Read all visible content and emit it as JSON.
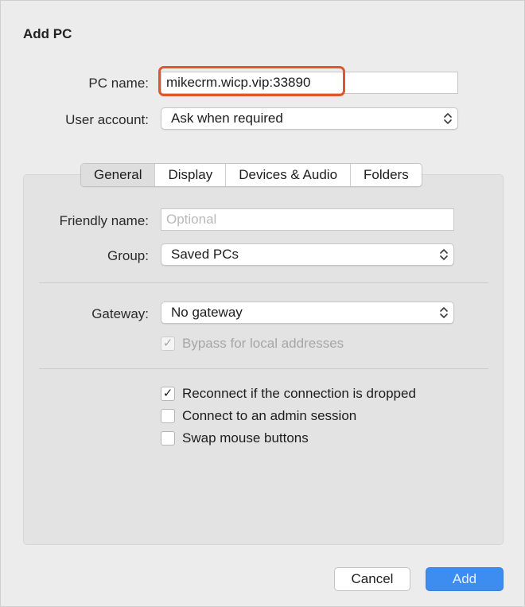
{
  "dialog": {
    "title": "Add PC"
  },
  "form": {
    "pc_name_label": "PC name:",
    "pc_name_value": "mikecrm.wicp.vip:33890",
    "user_account_label": "User account:",
    "user_account_value": "Ask when required"
  },
  "tabs": [
    {
      "label": "General",
      "active": true
    },
    {
      "label": "Display",
      "active": false
    },
    {
      "label": "Devices & Audio",
      "active": false
    },
    {
      "label": "Folders",
      "active": false
    }
  ],
  "general": {
    "friendly_name_label": "Friendly name:",
    "friendly_name_placeholder": "Optional",
    "friendly_name_value": "",
    "group_label": "Group:",
    "group_value": "Saved PCs",
    "gateway_label": "Gateway:",
    "gateway_value": "No gateway",
    "bypass_label": "Bypass for local addresses",
    "bypass_checked": true,
    "bypass_enabled": false,
    "reconnect_label": "Reconnect if the connection is dropped",
    "reconnect_checked": true,
    "admin_label": "Connect to an admin session",
    "admin_checked": false,
    "swap_label": "Swap mouse buttons",
    "swap_checked": false
  },
  "buttons": {
    "cancel_label": "Cancel",
    "add_label": "Add"
  },
  "colors": {
    "highlight": "#e0572c",
    "accent": "#3d8cf0"
  },
  "icons": {
    "checkmark": "✓",
    "popup": "chevron-updown-icon"
  }
}
